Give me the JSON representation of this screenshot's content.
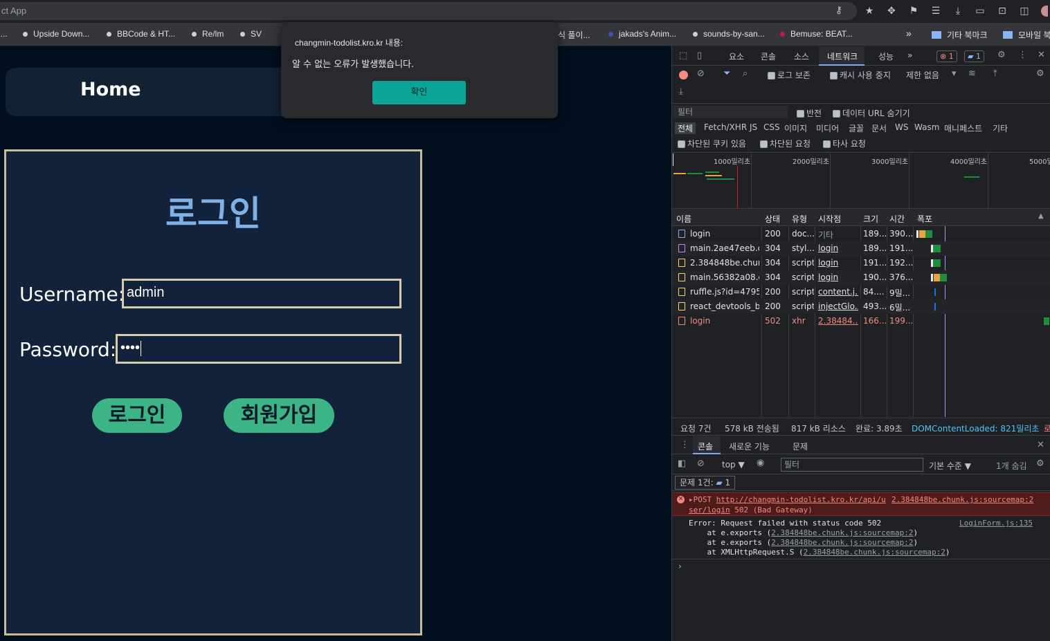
{
  "browser": {
    "url_fragment": "ct App",
    "bookmarks": [
      {
        "label": "l...",
        "dot": "none"
      },
      {
        "label": "Upside Down...",
        "dot": "#d0d0d0"
      },
      {
        "label": "BBCode & HT...",
        "dot": "#d0d0d0"
      },
      {
        "label": "Re/lm",
        "dot": "#d0d0d0"
      },
      {
        "label": "SV",
        "dot": "#d0d0d0"
      },
      {
        "label": "식 풀이...",
        "dot": "none"
      },
      {
        "label": "jakads's Anim...",
        "dot": "#3f51b5"
      },
      {
        "label": "sounds-by-san...",
        "dot": "#d0d0d0"
      },
      {
        "label": "Bemuse: BEAT...",
        "dot": "#c2185b"
      }
    ],
    "overflow": "»",
    "other_bookmarks": "기타 북마크",
    "mobile_bookmarks": "모바일 북"
  },
  "page": {
    "nav_home": "Home",
    "login_title": "로그인",
    "username_label": "Username:",
    "username_value": "admin",
    "password_label": "Password:",
    "password_value": "••••",
    "login_button": "로그인",
    "signup_button": "회원가입"
  },
  "alert": {
    "title": "changmin-todolist.kro.kr 내용:",
    "message": "알 수 없는 오류가 발생했습니다.",
    "ok_button": "확인"
  },
  "devtools": {
    "tabs": [
      "요소",
      "콘솔",
      "소스",
      "네트워크",
      "성능",
      "»"
    ],
    "active_tab": "네트워크",
    "error_count": "1",
    "message_count": "1",
    "preserve_log": "로그 보존",
    "disable_cache": "캐시 사용 중지",
    "throttling": "제한 없음",
    "filter_placeholder": "필터",
    "invert": "반전",
    "hide_data_urls": "데이터 URL 숨기기",
    "type_filters": [
      "전체",
      "Fetch/XHR",
      "JS",
      "CSS",
      "이미지",
      "미디어",
      "글꼴",
      "문서",
      "WS",
      "Wasm",
      "매니페스트",
      "기타"
    ],
    "blocked_cookies": "차단된 쿠키 있음",
    "blocked_requests": "차단된 요청",
    "third_party": "타사 요청",
    "timeline_labels": [
      "1000밀리초",
      "2000밀리초",
      "3000밀리초",
      "4000밀리초",
      "5000밀"
    ],
    "columns": [
      "이름",
      "상태",
      "유형",
      "시작점",
      "크기",
      "시간",
      "폭포"
    ],
    "rows": [
      {
        "name": "login",
        "status": "200",
        "type": "doc...",
        "initiator": "기타",
        "size": "189...",
        "time": "390...",
        "icon_color": "#8ab4f8"
      },
      {
        "name": "main.2ae47eeb.c...",
        "status": "304",
        "type": "styl...",
        "initiator": "login",
        "size": "189...",
        "time": "191...",
        "icon_color": "#c58af9"
      },
      {
        "name": "2.384848be.chun...",
        "status": "304",
        "type": "script",
        "initiator": "login",
        "size": "191...",
        "time": "192...",
        "icon_color": "#fdd663"
      },
      {
        "name": "main.56382a08.c...",
        "status": "304",
        "type": "script",
        "initiator": "login",
        "size": "190...",
        "time": "376...",
        "icon_color": "#fdd663"
      },
      {
        "name": "ruffle.js?id=4795...",
        "status": "200",
        "type": "script",
        "initiator": "content.j...",
        "size": "84....",
        "time": "9밀...",
        "icon_color": "#fdd663"
      },
      {
        "name": "react_devtools_b...",
        "status": "200",
        "type": "script",
        "initiator": "injectGlo...",
        "size": "493...",
        "time": "6밀...",
        "icon_color": "#fdd663"
      },
      {
        "name": "login",
        "status": "502",
        "type": "xhr",
        "initiator": "2.38484...",
        "size": "166...",
        "time": "199...",
        "icon_color": "#f28b82"
      }
    ],
    "summary": {
      "requests": "요청 7건",
      "transferred": "578 kB 전송됨",
      "resources": "817 kB 리소스",
      "finish": "완료: 3.89초",
      "dcl": "DOMContentLoaded: 821밀리초",
      "load": "로"
    },
    "drawer_tabs": [
      "콘솔",
      "새로운 기능",
      "문제"
    ],
    "context": "top ▼",
    "console_filter": "필터",
    "levels": "기본 수준 ▼",
    "hidden": "1개 숨김",
    "issues": "문제 1건:",
    "issues_count": "1",
    "error_line1_prefix": "▸POST ",
    "error_url_a": "http://changmin-todolist.kro.kr/api/u",
    "error_url_b": "ser/login",
    "error_status": " 502 (Bad Gateway)",
    "error_source": "2.384848be.chunk.js:sourcemap:2",
    "stack_msg": "Error: Request failed with status code 502",
    "stack_source": "LoginForm.js:135",
    "stack_lines": [
      {
        "prefix": "    at e.exports (",
        "link": "2.384848be.chunk.js:sourcemap:2",
        "suffix": ")"
      },
      {
        "prefix": "    at e.exports (",
        "link": "2.384848be.chunk.js:sourcemap:2",
        "suffix": ")"
      },
      {
        "prefix": "    at XMLHttpRequest.S (",
        "link": "2.384848be.chunk.js:sourcemap:2",
        "suffix": ")"
      }
    ],
    "prompt": "›"
  }
}
